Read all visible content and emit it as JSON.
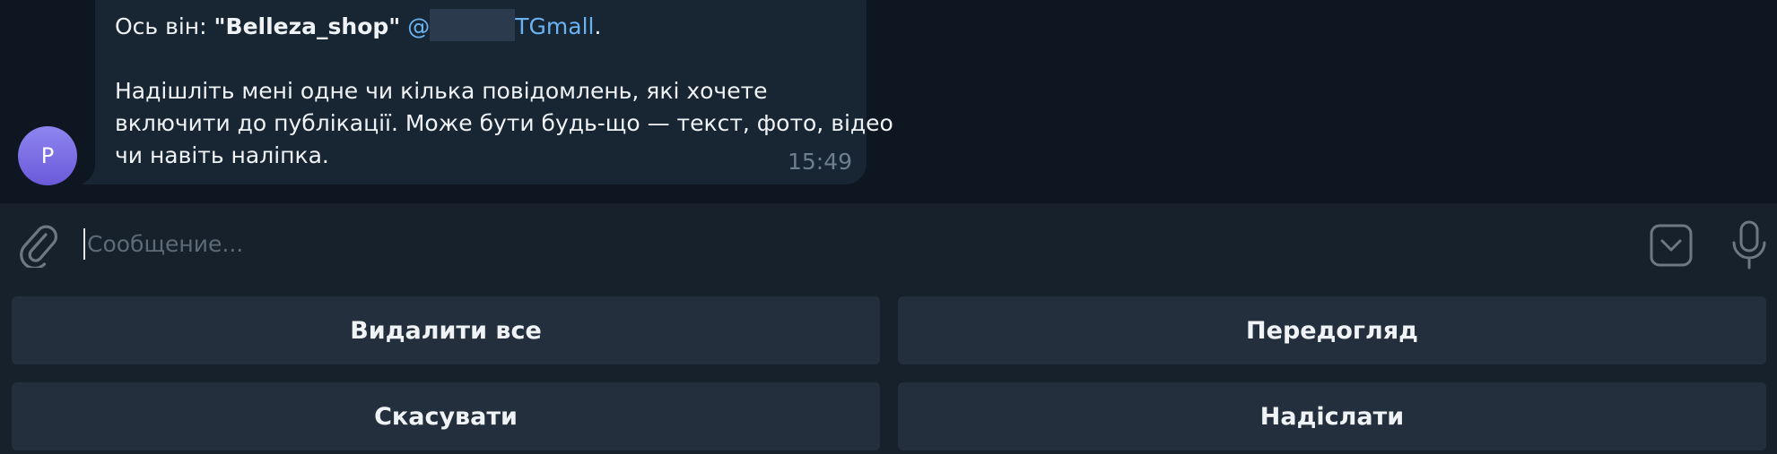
{
  "message": {
    "avatar_initial": "P",
    "line1_prefix": "Ось він: ",
    "line1_bold": "\"Belleza_shop\"",
    "line1_mention_prefix": "@",
    "line1_mention_suffix": "TGmall",
    "line1_end": ".",
    "line2": "Надішліть мені одне чи кілька повідомлень, які хочете",
    "line3": "включити до публікації. Може бути будь-що — текст, фото, відео",
    "line4": "чи навіть наліпка.",
    "time": "15:49"
  },
  "composer": {
    "placeholder": "Сообщение..."
  },
  "keyboard": {
    "delete_all": "Видалити все",
    "preview": "Передогляд",
    "cancel": "Скасувати",
    "send": "Надіслати"
  },
  "colors": {
    "background": "#0e1621",
    "bubble": "#182533",
    "panel": "#17212b",
    "button": "#232f3c",
    "link": "#6ab3f3",
    "avatar": "#7b6fe6"
  },
  "icons": {
    "attach": "paperclip-icon",
    "keyboard_toggle": "chevron-down-box-icon",
    "voice": "microphone-icon"
  }
}
